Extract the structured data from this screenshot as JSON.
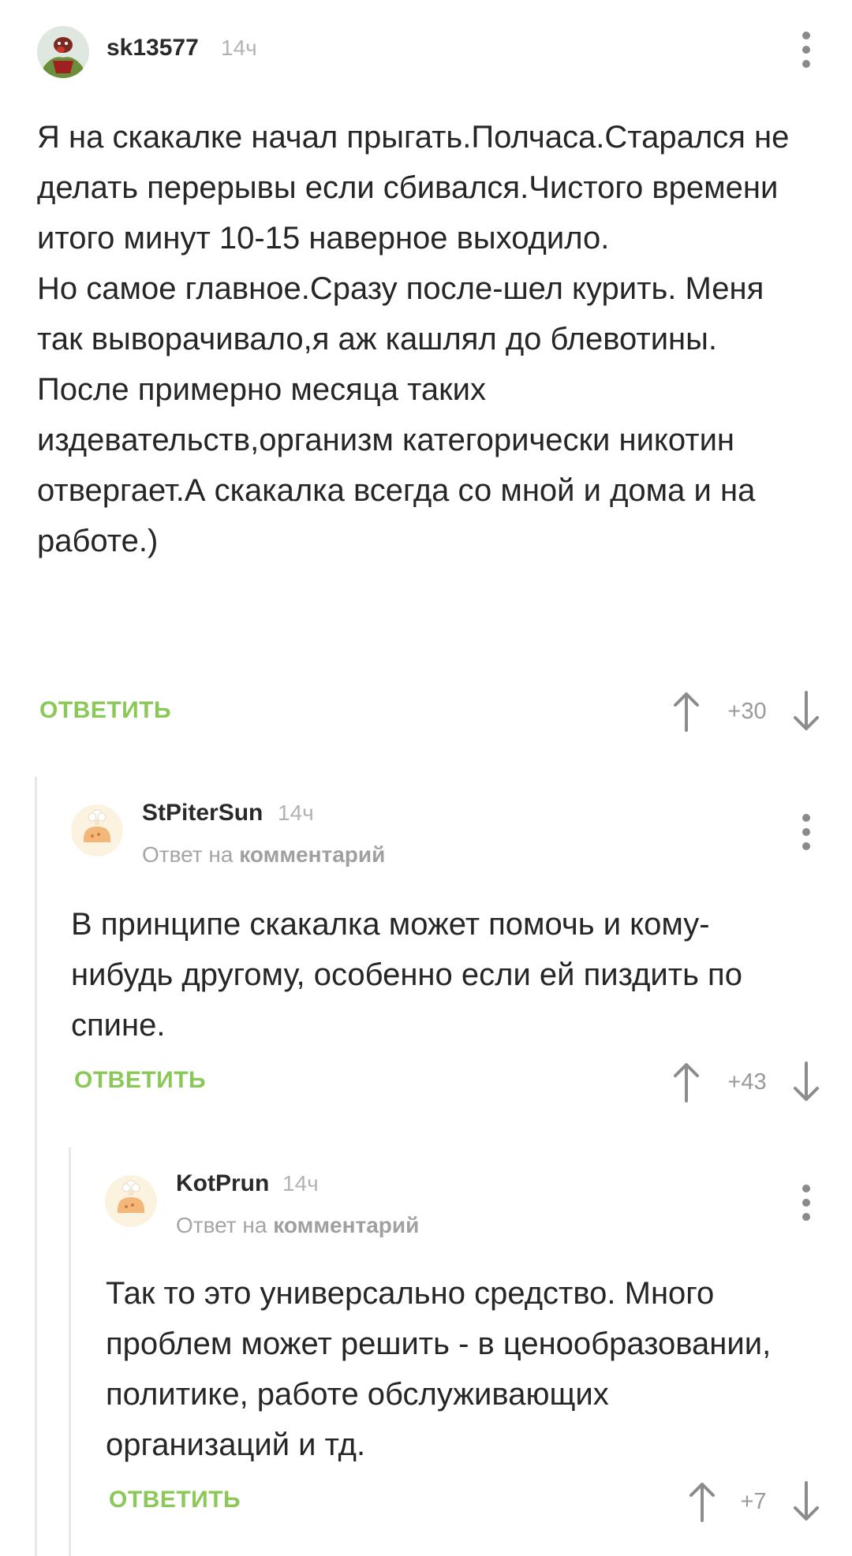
{
  "comments": [
    {
      "username": "sk13577",
      "time": "14ч",
      "reply_prefix": "",
      "reply_target": "",
      "paragraphs": [
        "Я на скакалке начал прыгать.Полчаса.Старался не делать перерывы если сбивался.Чистого времени итого минут 10-15 наверное выходило.",
        "Но самое главное.Сразу после-шел курить. Меня так выворачивало,я аж кашлял до блевотины.",
        "После примерно месяца таких издевательств,организм категорически никотин отвергает.А скакалка всегда со мной и дома и на работе.)"
      ],
      "reply_label": "ОТВЕТИТЬ",
      "rating": "+30"
    },
    {
      "username": "StPiterSun",
      "time": "14ч",
      "reply_prefix": "Ответ на",
      "reply_target": "комментарий",
      "paragraphs": [
        "В принципе скакалка может помочь и кому-нибудь другому, особенно если ей пиздить по спине."
      ],
      "reply_label": "ОТВЕТИТЬ",
      "rating": "+43"
    },
    {
      "username": "KotPrun",
      "time": "14ч",
      "reply_prefix": "Ответ на",
      "reply_target": "комментарий",
      "paragraphs": [
        "Так то это универсально средство. Много проблем может решить - в ценообразовании, политике, работе обслуживающих организаций и тд."
      ],
      "reply_label": "ОТВЕТИТЬ",
      "rating": "+7"
    }
  ],
  "icons": {
    "upvote": "arrow-up-icon",
    "downvote": "arrow-down-icon",
    "menu": "more-vertical-icon"
  },
  "colors": {
    "accent_green": "#8ac858",
    "thread_line": "#e8e8e8",
    "muted": "#b3b3b3"
  }
}
